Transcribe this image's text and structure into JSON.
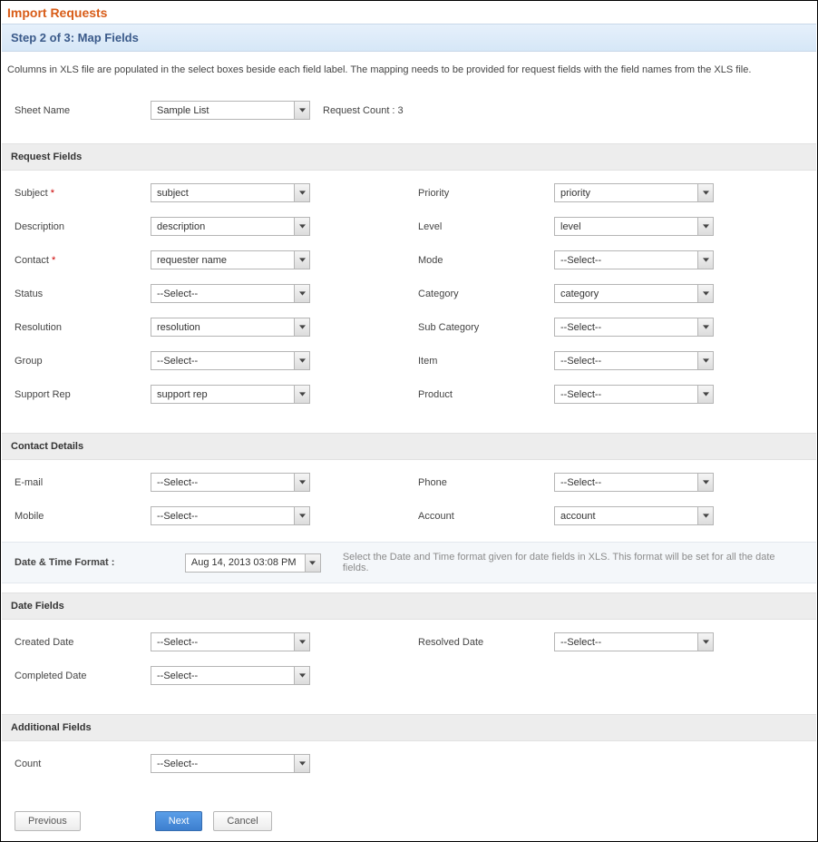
{
  "header": {
    "title": "Import Requests"
  },
  "step": {
    "label": "Step 2 of 3: Map Fields"
  },
  "instructionsText": "Columns in XLS file are populated in the select boxes beside each field label. The mapping needs to be provided for request fields with the field names from the XLS file.",
  "sheet": {
    "label": "Sheet Name",
    "value": "Sample List",
    "requestCountLabel": "Request Count : 3"
  },
  "sections": {
    "requestFields": {
      "heading": "Request Fields",
      "left": [
        {
          "label": "Subject",
          "required": true,
          "value": "subject"
        },
        {
          "label": "Description",
          "required": false,
          "value": "description"
        },
        {
          "label": "Contact",
          "required": true,
          "value": "requester name"
        },
        {
          "label": "Status",
          "required": false,
          "value": "--Select--"
        },
        {
          "label": "Resolution",
          "required": false,
          "value": "resolution"
        },
        {
          "label": "Group",
          "required": false,
          "value": "--Select--"
        },
        {
          "label": "Support Rep",
          "required": false,
          "value": "support rep"
        }
      ],
      "right": [
        {
          "label": "Priority",
          "value": "priority"
        },
        {
          "label": "Level",
          "value": "level"
        },
        {
          "label": "Mode",
          "value": "--Select--"
        },
        {
          "label": "Category",
          "value": "category"
        },
        {
          "label": "Sub Category",
          "value": "--Select--"
        },
        {
          "label": "Item",
          "value": "--Select--"
        },
        {
          "label": "Product",
          "value": "--Select--"
        }
      ]
    },
    "contactDetails": {
      "heading": "Contact Details",
      "left": [
        {
          "label": "E-mail",
          "value": "--Select--"
        },
        {
          "label": "Mobile",
          "value": "--Select--"
        }
      ],
      "right": [
        {
          "label": "Phone",
          "value": "--Select--"
        },
        {
          "label": "Account",
          "value": "account"
        }
      ]
    },
    "dateTime": {
      "label": "Date & Time Format :",
      "value": "Aug 14, 2013 03:08 PM",
      "help": "Select the Date and Time format given for date fields in XLS. This format will be set for all the date fields."
    },
    "dateFields": {
      "heading": "Date Fields",
      "left": [
        {
          "label": "Created Date",
          "value": "--Select--"
        },
        {
          "label": "Completed Date",
          "value": "--Select--"
        }
      ],
      "right": [
        {
          "label": "Resolved Date",
          "value": "--Select--"
        },
        null
      ]
    },
    "additionalFields": {
      "heading": "Additional Fields",
      "left": [
        {
          "label": "Count",
          "value": "--Select--"
        }
      ],
      "right": [
        null
      ]
    }
  },
  "buttons": {
    "previous": "Previous",
    "next": "Next",
    "cancel": "Cancel"
  }
}
